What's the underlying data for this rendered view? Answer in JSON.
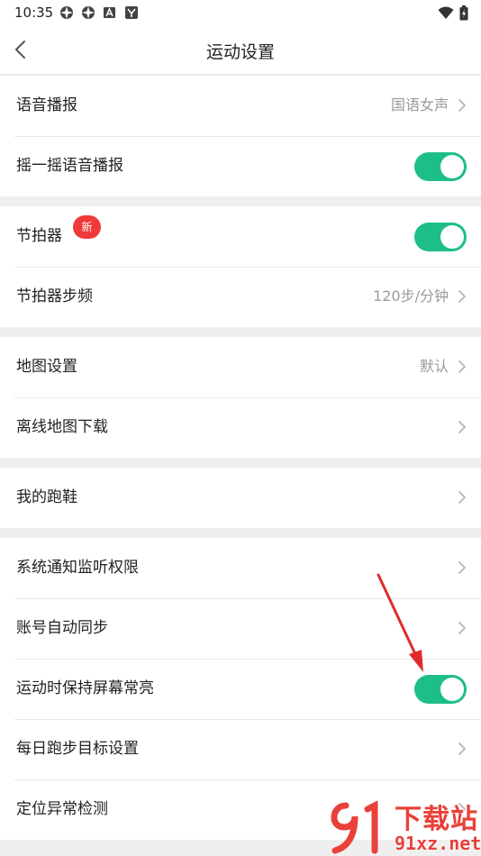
{
  "status_bar": {
    "time": "10:35"
  },
  "nav": {
    "title": "运动设置"
  },
  "groups": [
    {
      "rows": [
        {
          "label": "语音播报",
          "value": "国语女声",
          "control": "chevron"
        },
        {
          "label": "摇一摇语音播报",
          "control": "toggle",
          "on": true
        }
      ]
    },
    {
      "rows": [
        {
          "label": "节拍器",
          "badge": "新",
          "control": "toggle",
          "on": true
        },
        {
          "label": "节拍器步频",
          "value": "120步/分钟",
          "control": "chevron"
        }
      ]
    },
    {
      "rows": [
        {
          "label": "地图设置",
          "value": "默认",
          "control": "chevron"
        },
        {
          "label": "离线地图下载",
          "control": "chevron"
        }
      ]
    },
    {
      "rows": [
        {
          "label": "我的跑鞋",
          "control": "chevron"
        }
      ]
    },
    {
      "rows": [
        {
          "label": "系统通知监听权限",
          "control": "chevron"
        },
        {
          "label": "账号自动同步",
          "control": "chevron"
        },
        {
          "label": "运动时保持屏幕常亮",
          "control": "toggle",
          "on": true
        },
        {
          "label": "每日跑步目标设置",
          "control": "chevron"
        },
        {
          "label": "定位异常检测",
          "control": "chevron"
        }
      ]
    }
  ],
  "watermark": {
    "text_top": "下载站",
    "text_bottom": "91xz.net"
  },
  "colors": {
    "toggle_on": "#1dbf86",
    "badge": "#f03a3a",
    "annotation_arrow": "#e02a2a"
  }
}
